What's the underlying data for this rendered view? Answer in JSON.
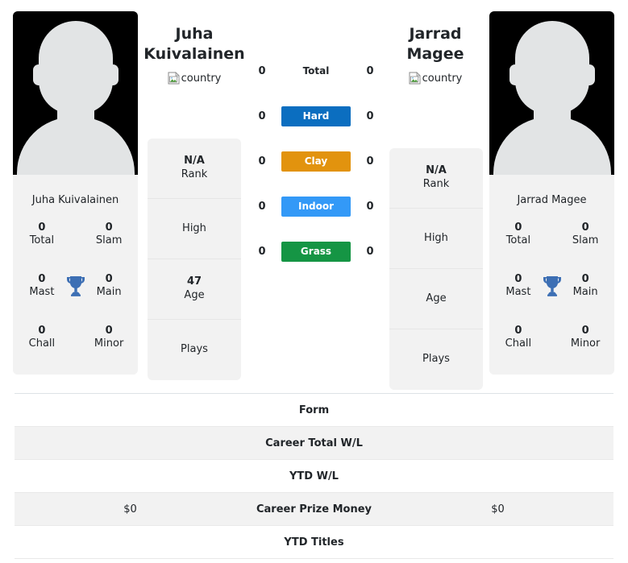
{
  "players": {
    "left": {
      "name": "Juha Kuivalainen",
      "name_line1": "Juha",
      "name_line2": "Kuivalainen",
      "photo_caption": "Juha Kuivalainen",
      "flag_alt": "country",
      "titles": {
        "total_value": "0",
        "total_label": "Total",
        "slam_value": "0",
        "slam_label": "Slam",
        "mast_value": "0",
        "mast_label": "Mast",
        "main_value": "0",
        "main_label": "Main",
        "chall_value": "0",
        "chall_label": "Chall",
        "minor_value": "0",
        "minor_label": "Minor"
      },
      "info": [
        {
          "value": "N/A",
          "label": "Rank"
        },
        {
          "value": "",
          "label": "High"
        },
        {
          "value": "47",
          "label": "Age"
        },
        {
          "value": "",
          "label": "Plays"
        }
      ]
    },
    "right": {
      "name": "Jarrad Magee",
      "name_line1": "Jarrad",
      "name_line2": "Magee",
      "photo_caption": "Jarrad Magee",
      "flag_alt": "country",
      "titles": {
        "total_value": "0",
        "total_label": "Total",
        "slam_value": "0",
        "slam_label": "Slam",
        "mast_value": "0",
        "mast_label": "Mast",
        "main_value": "0",
        "main_label": "Main",
        "chall_value": "0",
        "chall_label": "Chall",
        "minor_value": "0",
        "minor_label": "Minor"
      },
      "info": [
        {
          "value": "N/A",
          "label": "Rank"
        },
        {
          "value": "",
          "label": "High"
        },
        {
          "value": "",
          "label": "Age"
        },
        {
          "value": "",
          "label": "Plays"
        }
      ]
    }
  },
  "h2h": {
    "rows": [
      {
        "label": "Total",
        "left": "0",
        "right": "0",
        "style": "plain",
        "color": ""
      },
      {
        "label": "Hard",
        "left": "0",
        "right": "0",
        "style": "badge",
        "color": "#0b6ec0"
      },
      {
        "label": "Clay",
        "left": "0",
        "right": "0",
        "style": "badge",
        "color": "#e2930e"
      },
      {
        "label": "Indoor",
        "left": "0",
        "right": "0",
        "style": "badge",
        "color": "#3399f7"
      },
      {
        "label": "Grass",
        "left": "0",
        "right": "0",
        "style": "badge",
        "color": "#159544"
      }
    ]
  },
  "stats_table": {
    "rows": [
      {
        "label": "Form",
        "left": "",
        "right": "",
        "shaded": false
      },
      {
        "label": "Career Total W/L",
        "left": "",
        "right": "",
        "shaded": true
      },
      {
        "label": "YTD W/L",
        "left": "",
        "right": "",
        "shaded": false
      },
      {
        "label": "Career Prize Money",
        "left": "$0",
        "right": "$0",
        "shaded": true
      },
      {
        "label": "YTD Titles",
        "left": "",
        "right": "",
        "shaded": false
      }
    ]
  },
  "icons": {
    "trophy": "trophy-icon",
    "broken_image": "broken-image-icon",
    "avatar": "avatar-silhouette-icon"
  },
  "colors": {
    "hard": "#0b6ec0",
    "clay": "#e2930e",
    "indoor": "#3399f7",
    "grass": "#159544",
    "trophy": "#3d6fb4",
    "panel_bg": "#f2f2f2"
  }
}
